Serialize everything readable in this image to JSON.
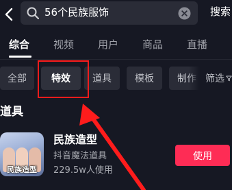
{
  "search": {
    "query": "56个民族服饰",
    "button_label": "搜索"
  },
  "tabs": [
    {
      "label": "综合",
      "active": true
    },
    {
      "label": "视频",
      "active": false
    },
    {
      "label": "用户",
      "active": false
    },
    {
      "label": "商品",
      "active": false
    },
    {
      "label": "直播",
      "active": false
    }
  ],
  "filters": {
    "chips": [
      {
        "label": "全部",
        "active": false
      },
      {
        "label": "特效",
        "active": true
      },
      {
        "label": "道具",
        "active": false
      },
      {
        "label": "模板",
        "active": false
      },
      {
        "label": "制作",
        "active": false
      }
    ],
    "filter_label": "筛选"
  },
  "section": {
    "title": "道具"
  },
  "result": {
    "title": "民族造型",
    "subtitle": "抖音魔法道具",
    "usage_count": "229.5w人使用",
    "thumbnail_caption": "民族造型",
    "button_label": "使用"
  },
  "colors": {
    "background": "#161823",
    "accent": "#fe2c55",
    "annotation": "#ff1c1c"
  }
}
